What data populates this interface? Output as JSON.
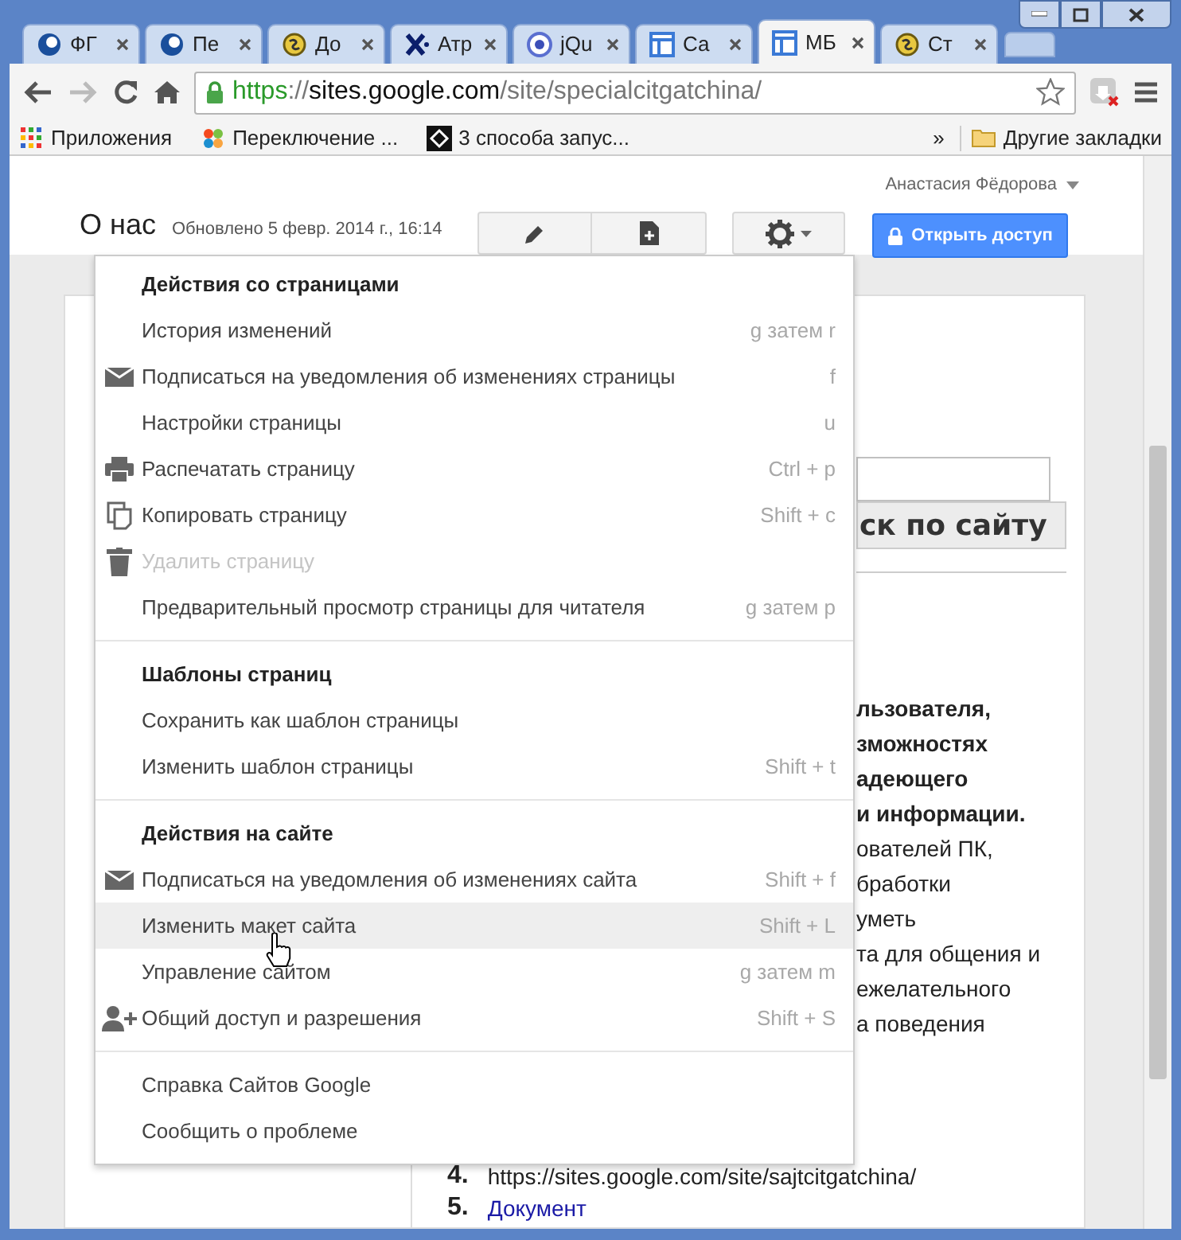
{
  "tabs": [
    {
      "label": "ФГ",
      "kind": "globe",
      "selected": false
    },
    {
      "label": "Пе",
      "kind": "globe",
      "selected": false
    },
    {
      "label": "До",
      "kind": "coin",
      "selected": false
    },
    {
      "label": "Атр",
      "kind": "cross",
      "selected": false
    },
    {
      "label": "jQu",
      "kind": "ring",
      "selected": false
    },
    {
      "label": "Са",
      "kind": "layout",
      "selected": false
    },
    {
      "label": "МБ",
      "kind": "layout",
      "selected": true
    },
    {
      "label": "Ст",
      "kind": "coin",
      "selected": false
    }
  ],
  "url": {
    "scheme": "https",
    "separator": "://",
    "host": "sites.google.com",
    "path": "/site/specialcitgatchina/"
  },
  "bookmarks": [
    {
      "label": "Приложения",
      "kind": "apps"
    },
    {
      "label": "Переключение ...",
      "kind": "star"
    },
    {
      "label": "3 способа запус...",
      "kind": "code"
    }
  ],
  "bookmarks_overflow": "»",
  "other_bookmarks": "Другие закладки",
  "user": "Анастасия Фёдорова",
  "page": {
    "title": "О нас",
    "updated": "Обновлено 5 февр. 2014 г., 16:14",
    "share_button": "Открыть доступ"
  },
  "menu": {
    "sections": [
      {
        "heading": "Действия со страницами",
        "items": [
          {
            "label": "История изменений",
            "shortcut": "g затем r",
            "kind": "plain",
            "disabled": false,
            "hovered": false
          },
          {
            "label": "Подписаться на уведомления об изменениях страницы",
            "shortcut": "f",
            "kind": "mail",
            "disabled": false,
            "hovered": false
          },
          {
            "label": "Настройки страницы",
            "shortcut": "u",
            "kind": "plain",
            "disabled": false,
            "hovered": false
          },
          {
            "label": "Распечатать страницу",
            "shortcut": "Ctrl + p",
            "kind": "print",
            "disabled": false,
            "hovered": false
          },
          {
            "label": "Копировать страницу",
            "shortcut": "Shift + c",
            "kind": "copy",
            "disabled": false,
            "hovered": false
          },
          {
            "label": "Удалить страницу",
            "kind": "trash",
            "disabled": true,
            "hovered": false
          },
          {
            "label": "Предварительный просмотр страницы для читателя",
            "shortcut": "g затем p",
            "kind": "plain",
            "disabled": false,
            "hovered": false
          }
        ]
      },
      {
        "heading": "Шаблоны страниц",
        "items": [
          {
            "label": "Сохранить как шаблон страницы",
            "kind": "plain",
            "disabled": false,
            "hovered": false
          },
          {
            "label": "Изменить шаблон страницы",
            "shortcut": "Shift + t",
            "kind": "plain",
            "disabled": false,
            "hovered": false
          }
        ]
      },
      {
        "heading": "Действия на сайте",
        "items": [
          {
            "label": "Подписаться на уведомления об изменениях сайта",
            "shortcut": "Shift + f",
            "kind": "mail",
            "disabled": false,
            "hovered": false
          },
          {
            "label": "Изменить макет сайта",
            "shortcut": "Shift + L",
            "kind": "plain",
            "disabled": false,
            "hovered": true
          },
          {
            "label": "Управление сайтом",
            "shortcut": "g затем m",
            "kind": "plain",
            "disabled": false,
            "hovered": false
          },
          {
            "label": "Общий доступ и разрешения",
            "shortcut": "Shift + S",
            "kind": "person-add",
            "disabled": false,
            "hovered": false
          }
        ]
      },
      {
        "items": [
          {
            "label": "Справка Сайтов Google",
            "kind": "plain",
            "disabled": false,
            "hovered": false
          },
          {
            "label": "Сообщить о проблеме",
            "kind": "plain",
            "disabled": false,
            "hovered": false
          }
        ]
      }
    ]
  },
  "content": {
    "search_button": "ск по сайту",
    "lines": [
      {
        "text": "льзователя,",
        "bold": true
      },
      {
        "text": "зможностях",
        "bold": true
      },
      {
        "text": "адеющего",
        "bold": true
      },
      {
        "text": "и информации.",
        "bold": true
      },
      {
        "text": "ователей ПК,",
        "bold": false
      },
      {
        "text": "бработки",
        "bold": false
      },
      {
        "text": "уметь",
        "bold": false
      },
      {
        "text": "та для общения и",
        "bold": false
      },
      {
        "text": "ежелательного",
        "bold": false
      },
      {
        "text": "а поведения",
        "bold": false
      }
    ],
    "list": [
      {
        "number": "4.",
        "text": "https://sites.google.com/site/sajtcitgatchina/",
        "kind": "plain"
      },
      {
        "number": "5.",
        "text": "Документ",
        "kind": "link"
      }
    ]
  }
}
